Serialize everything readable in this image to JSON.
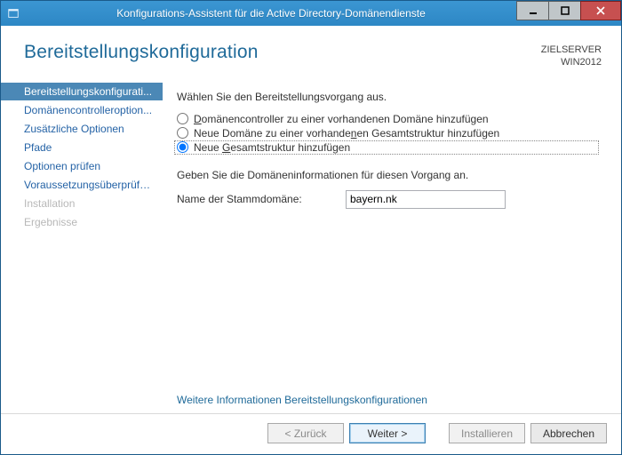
{
  "window": {
    "title": "Konfigurations-Assistent für die Active Directory-Domänendienste"
  },
  "header": {
    "title": "Bereitstellungskonfiguration",
    "target_label": "ZIELSERVER",
    "target_value": "WIN2012"
  },
  "sidebar": {
    "items": [
      {
        "label": "Bereitstellungskonfigurati...",
        "state": "active"
      },
      {
        "label": "Domänencontrolleroption...",
        "state": "normal"
      },
      {
        "label": "Zusätzliche Optionen",
        "state": "normal"
      },
      {
        "label": "Pfade",
        "state": "normal"
      },
      {
        "label": "Optionen prüfen",
        "state": "normal"
      },
      {
        "label": "Voraussetzungsüberprüfu...",
        "state": "normal"
      },
      {
        "label": "Installation",
        "state": "disabled"
      },
      {
        "label": "Ergebnisse",
        "state": "disabled"
      }
    ]
  },
  "content": {
    "instruction1": "Wählen Sie den Bereitstellungsvorgang aus.",
    "radios": [
      {
        "label_pre": "",
        "mne": "D",
        "label_post": "omänencontroller zu einer vorhandenen Domäne hinzufügen",
        "checked": false
      },
      {
        "label_pre": "Neue Domäne zu einer vorhande",
        "mne": "n",
        "label_post": "en Gesamtstruktur hinzufügen",
        "checked": false
      },
      {
        "label_pre": "Neue ",
        "mne": "G",
        "label_post": "esamtstruktur hinzufügen",
        "checked": true
      }
    ],
    "instruction2": "Geben Sie die Domäneninformationen für diesen Vorgang an.",
    "root_domain_label": "Name der Stammdomäne:",
    "root_domain_value": "bayern.nk",
    "more_link": "Weitere Informationen Bereitstellungskonfigurationen"
  },
  "footer": {
    "back": "< Zurück",
    "next": "Weiter >",
    "install": "Installieren",
    "cancel": "Abbrechen"
  }
}
